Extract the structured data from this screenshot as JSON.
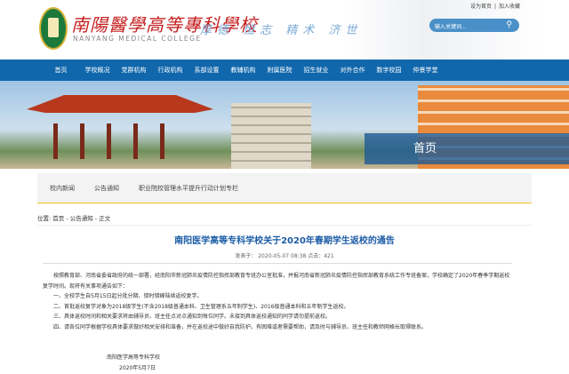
{
  "header": {
    "logo_cn": "南陽醫學高等專科學校",
    "logo_en": "NANYANG MEDICAL COLLEGE",
    "motto": "厚德 恒志 精术 济世",
    "links": [
      "设为首页",
      "加入收藏"
    ],
    "search_placeholder": "输入关键词...",
    "search_icon": "search-icon"
  },
  "nav": [
    "首页",
    "学校概况",
    "党群机构",
    "行政机构",
    "系部设置",
    "教辅机构",
    "附属医院",
    "招生就业",
    "对外合作",
    "数字校园",
    "仲景学堂"
  ],
  "banner": {
    "title": "首页"
  },
  "subnav": [
    "校内新闻",
    "公告通知",
    "职业院校管理水平提升行动计划专栏"
  ],
  "breadcrumb": "位置: 首页 - 公告通知 - 正文",
  "article": {
    "title": "南阳医学高等专科学校关于2020年春期学生返校的通告",
    "meta": "发表于： 2020-05-07 08:38 点击：421",
    "paragraphs": [
      "按照教育部、河南省委省政府的统一部署，经南阳市新冠肺炎疫情防控指挥部教育专班办公室批准，并报河南省新冠肺炎疫情防控指挥部教育系统工作专班备案，学校确定了2020年春季学期返校复学时间。现将有关事项通告如下：",
      "一、全校学生自5月15日起分批分期、错时错峰陆续返校复学。",
      "二、首批返校复学对象为2018级学生(不含2018级普通本科、卫生管理系五年制学生)、2016级普通本科和五年制学生返校。",
      "三、具体返校时间和相关要求将由辅导员、班主任点对点通知到每位同学。未接到具体返校通知的同学请勿提前返校。",
      "四、请各位同学根据学校具体要求做好相关安排和准备，并在返校途中做好自我防护。有困难或者需要帮助，请及时与辅导员、班主任和教师网格长取得联系。"
    ],
    "signature": "南阳医学高等专科学校",
    "date": "2020年5月7日"
  }
}
